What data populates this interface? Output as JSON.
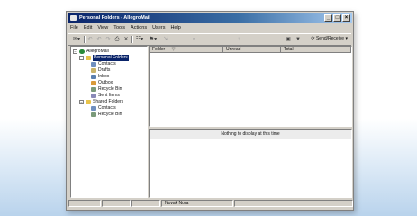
{
  "window": {
    "title": "Personal Folders - AllegroMail",
    "minimize": "_",
    "maximize": "□",
    "close": "×"
  },
  "menu": [
    "File",
    "Edit",
    "View",
    "Tools",
    "Actions",
    "Users",
    "Help"
  ],
  "toolbar": {
    "send_receive_label": "Send/Receive"
  },
  "tree": {
    "root": "AllegroMail",
    "personal_folders": "Personal Folders",
    "personal_items": [
      "Contacts",
      "Drafts",
      "Inbox",
      "Outbox",
      "Recycle Bin",
      "Sent Items"
    ],
    "shared_folders": "Shared Folders",
    "shared_items": [
      "Contacts",
      "Recycle Bin"
    ]
  },
  "list": {
    "columns": [
      "Folder",
      "Unread",
      "Total"
    ]
  },
  "preview": {
    "message": "Nothing to display at this time"
  },
  "status": {
    "panel_text": "Novak Nora"
  },
  "colors": {
    "titlebar_start": "#0a246a",
    "titlebar_end": "#a6caf0",
    "selection": "#0a246a",
    "window_face": "#d4d0c8"
  }
}
